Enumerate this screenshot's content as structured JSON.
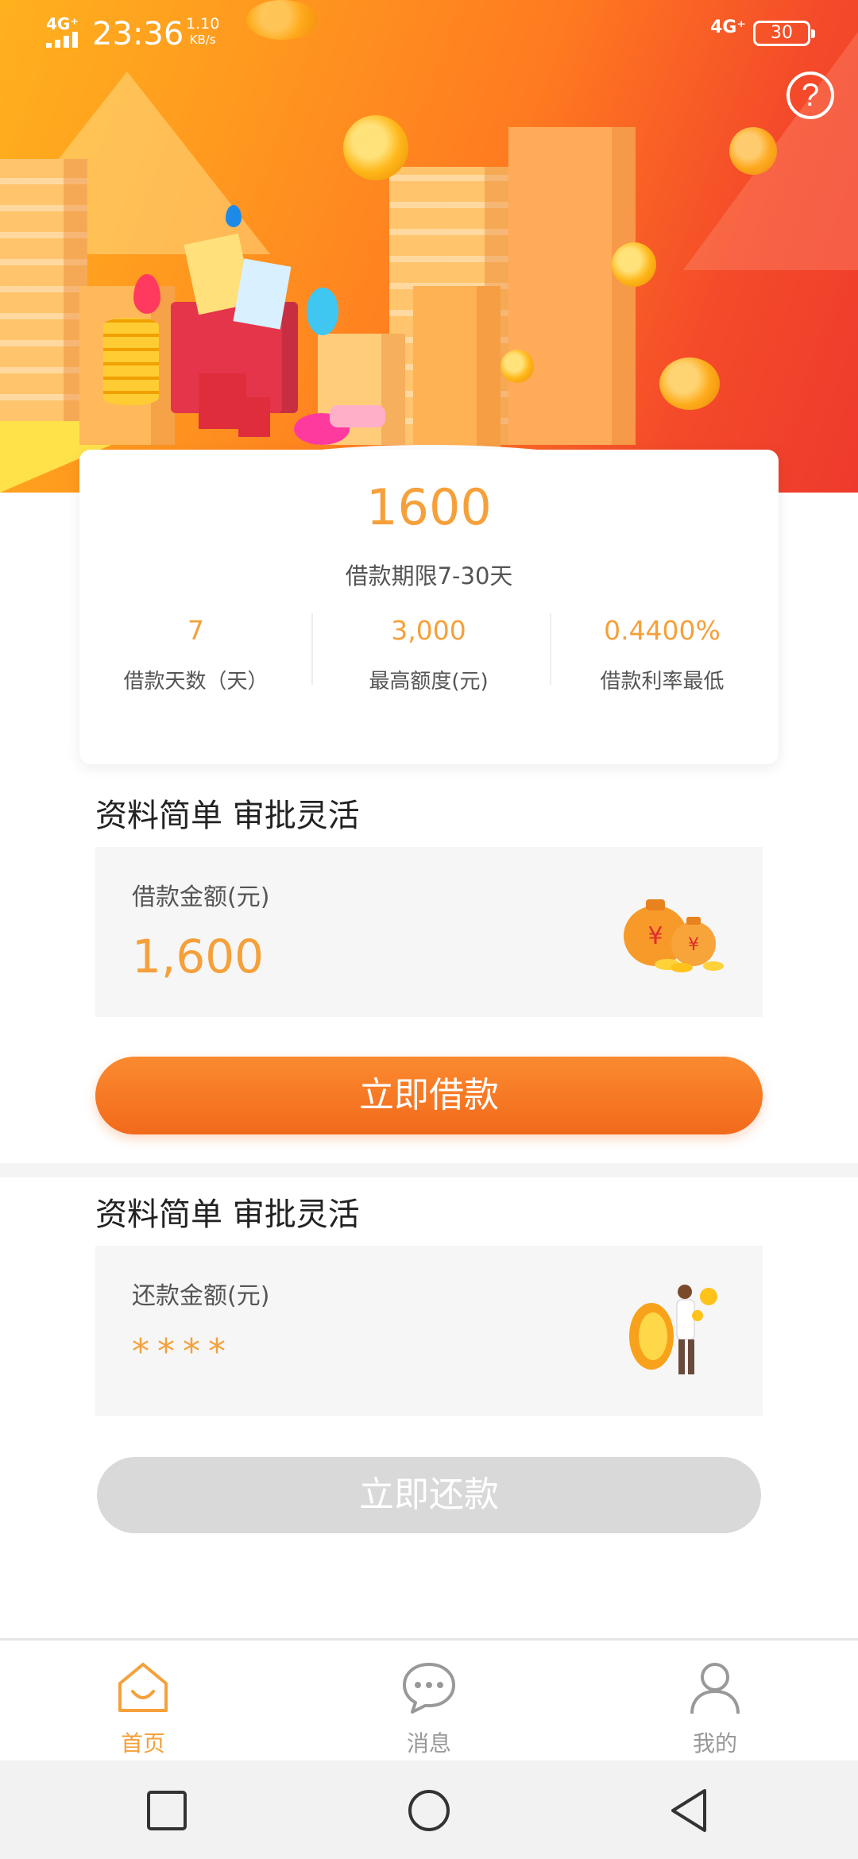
{
  "status_bar": {
    "network_left": "4G⁺",
    "time": "23:36",
    "speed_value": "1.10",
    "speed_unit": "KB/s",
    "network_right": "4G⁺",
    "battery": "30"
  },
  "hero": {
    "help_icon": "question-circle-icon"
  },
  "summary": {
    "amount": "1600",
    "term": "借款期限7-30天",
    "stats": [
      {
        "value": "7",
        "label": "借款天数（天）"
      },
      {
        "value": "3,000",
        "label": "最高额度(元)"
      },
      {
        "value": "0.4400%",
        "label": "借款利率最低"
      }
    ]
  },
  "borrow_section": {
    "title": "资料简单 审批灵活",
    "label": "借款金额(元)",
    "value": "1,600",
    "button": "立即借款",
    "icon": "money-bags-icon"
  },
  "repay_section": {
    "title": "资料简单 审批灵活",
    "label": "还款金额(元)",
    "value": "****",
    "button": "立即还款",
    "icon": "coin-man-icon"
  },
  "tabs": [
    {
      "label": "首页",
      "icon": "home-icon",
      "active": true
    },
    {
      "label": "消息",
      "icon": "message-icon",
      "active": false
    },
    {
      "label": "我的",
      "icon": "person-icon",
      "active": false
    }
  ],
  "colors": {
    "accent": "#f5a03a",
    "button": "#f26a1c",
    "active_tab": "#f5a03a",
    "inactive_tab": "#999999",
    "disabled_button": "#d9d9d9"
  }
}
